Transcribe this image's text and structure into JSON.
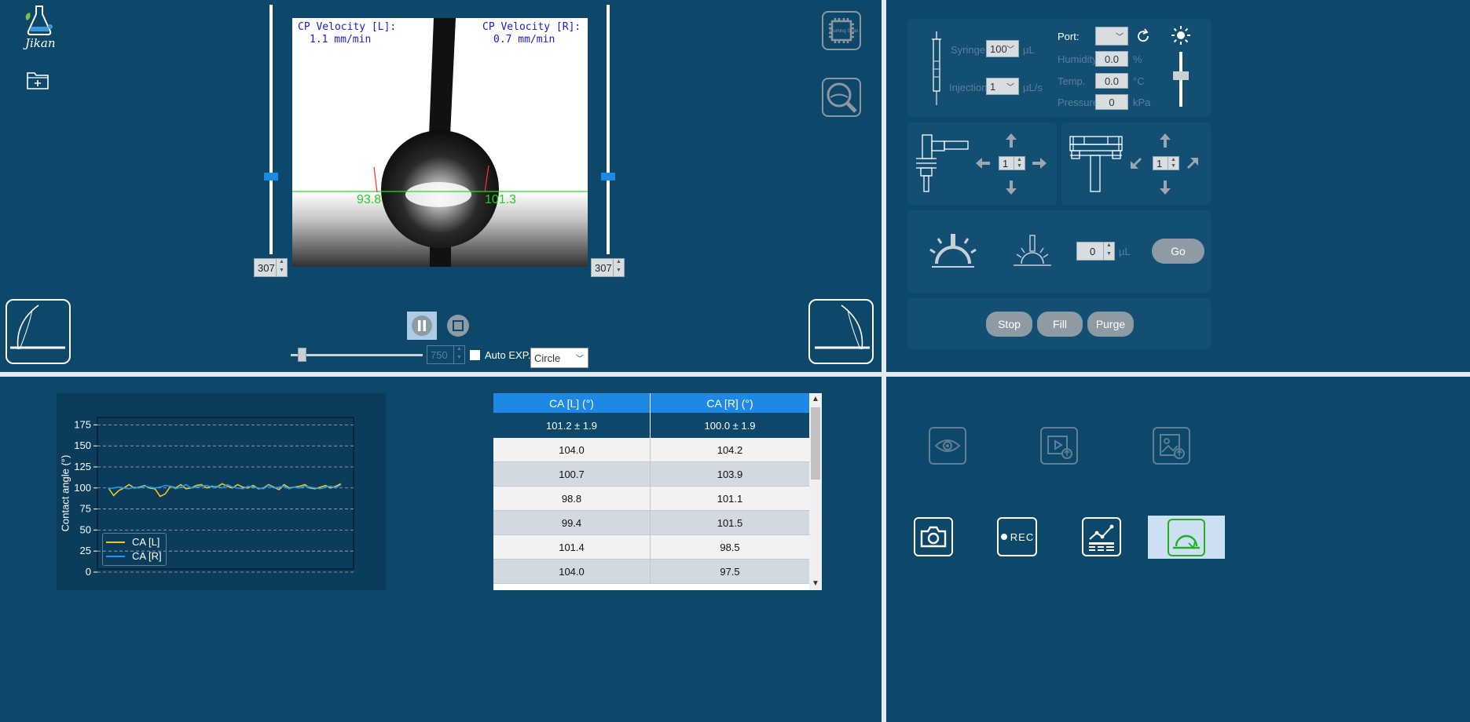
{
  "app": {
    "logo_text": "Jikan"
  },
  "camera": {
    "velocity_left_label": "CP Velocity [L]:",
    "velocity_left_value": "1.1 mm/min",
    "velocity_right_label": "CP Velocity [R]:",
    "velocity_right_value": "0.7 mm/min",
    "angle_left": "93.8",
    "angle_right": "101.3",
    "chip_label": "Cuming Sean"
  },
  "slider_left": {
    "value": "307"
  },
  "slider_right": {
    "value": "307"
  },
  "exposure": {
    "value": "750",
    "auto_label": "Auto EXP.",
    "fit_mode": "Circle"
  },
  "syringe": {
    "syringe_label": "Syringe",
    "syringe_value": "100",
    "syringe_unit": "µL",
    "injection_label": "Injection",
    "injection_value": "1",
    "injection_unit": "µL/s",
    "port_label": "Port:",
    "humidity_label": "Humidity",
    "humidity_value": "0.0",
    "humidity_unit": "%",
    "temp_label": "Temp.",
    "temp_value": "0.0",
    "temp_unit": "°C",
    "pressure_label": "Pressure",
    "pressure_value": "0",
    "pressure_unit": "kPa"
  },
  "stage_left": {
    "step": "1"
  },
  "stage_right": {
    "step": "1"
  },
  "dispense": {
    "volume": "0",
    "unit": "µL",
    "go_label": "Go"
  },
  "pump": {
    "stop_label": "Stop",
    "fill_label": "Fill",
    "purge_label": "Purge"
  },
  "table": {
    "headers": [
      "CA [L] (°)",
      "CA [R] (°)"
    ],
    "summary": [
      "101.2 ± 1.9",
      "100.0 ± 1.9"
    ],
    "rows": [
      [
        "104.0",
        "104.2"
      ],
      [
        "100.7",
        "103.9"
      ],
      [
        "98.8",
        "101.1"
      ],
      [
        "99.4",
        "101.5"
      ],
      [
        "101.4",
        "98.5"
      ],
      [
        "104.0",
        "97.5"
      ]
    ]
  },
  "toolbar": {
    "rec_label": "REC"
  },
  "colors": {
    "panel": "#0d4769",
    "accent": "#1e88e5",
    "series_left": "#f5c518",
    "series_right": "#2196f3"
  },
  "chart_data": {
    "type": "line",
    "ylabel": "Contact angle (°)",
    "xlabel": "",
    "ylim": [
      0,
      180
    ],
    "yticks": [
      0,
      25,
      50,
      75,
      100,
      125,
      150,
      175
    ],
    "grid": true,
    "legend_position": "bottom-left",
    "series": [
      {
        "name": "CA [L]",
        "color": "#f5c518",
        "values": [
          100,
          91,
          97,
          100,
          104,
          100,
          101,
          103,
          100,
          99,
          90,
          93,
          102,
          100,
          104,
          99,
          100,
          103,
          104,
          100,
          102,
          101,
          105,
          102,
          100,
          104,
          101,
          100,
          103,
          99,
          100,
          104,
          101,
          98,
          104,
          100,
          101,
          102,
          104,
          100,
          99,
          101,
          103,
          100,
          102,
          105
        ]
      },
      {
        "name": "CA [R]",
        "color": "#2196f3",
        "values": [
          99,
          100,
          101,
          100,
          99,
          101,
          100,
          102,
          101,
          100,
          101,
          103,
          102,
          99,
          101,
          104,
          100,
          101,
          102,
          103,
          101,
          102,
          100,
          104,
          101,
          100,
          99,
          102,
          101,
          100,
          99,
          103,
          100,
          101,
          102,
          99,
          101,
          100,
          102,
          101,
          100,
          99,
          101,
          102,
          100,
          104
        ]
      }
    ]
  }
}
